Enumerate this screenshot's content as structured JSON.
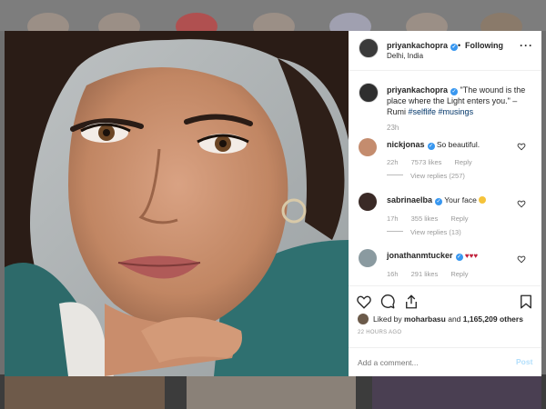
{
  "post": {
    "author": {
      "username": "priyankachopra",
      "verified": true,
      "follow_separator": "•",
      "follow_status": "Following",
      "location": "Delhi, India"
    },
    "more_icon": "more-options-icon",
    "caption": {
      "username": "priyankachopra",
      "text": "\"The wound is the place where the Light enters you.\" – Rumi",
      "hashtags": "#selflife #musings",
      "time": "23h"
    },
    "comments": [
      {
        "username": "nickjonas",
        "verified": true,
        "text": "So beautiful.",
        "time": "22h",
        "likes": "7573 likes",
        "reply": "Reply",
        "view_replies": "View replies (257)"
      },
      {
        "username": "sabrinaelba",
        "verified": true,
        "text": "Your face",
        "emoji": "heart-eyes-emoji",
        "time": "17h",
        "likes": "355 likes",
        "reply": "Reply",
        "view_replies": "View replies (13)"
      },
      {
        "username": "jonathanmtucker",
        "verified": true,
        "text": "♥♥♥",
        "time": "16h",
        "likes": "291 likes",
        "reply": "Reply"
      }
    ],
    "actions": {
      "like_icon": "heart-outline-icon",
      "comment_icon": "comment-bubble-icon",
      "share_icon": "share-icon",
      "save_icon": "bookmark-icon"
    },
    "likes_summary": {
      "prefix": "Liked by ",
      "user": "moharbasu",
      "middle": " and ",
      "count": "1,165,209 others"
    },
    "time_ago": "22 HOURS AGO",
    "add_comment": {
      "placeholder": "Add a comment...",
      "post_label": "Post"
    }
  },
  "colors": {
    "accent": "#3897f0",
    "link": "#003569",
    "muted": "#999999",
    "post_disabled": "#b2dffc"
  }
}
